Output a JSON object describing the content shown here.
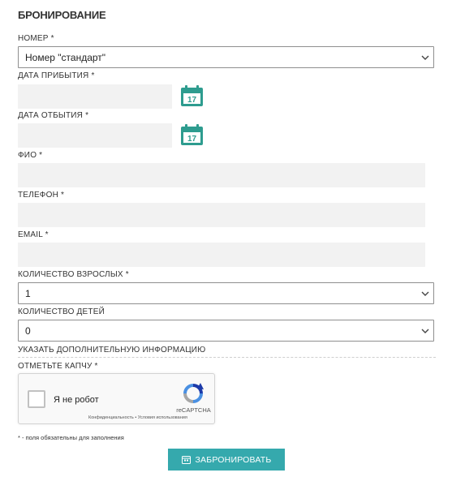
{
  "form": {
    "title": "БРОНИРОВАНИЕ",
    "room": {
      "label": "НОМЕР *",
      "value": "Номер \"стандарт\""
    },
    "arrival": {
      "label": "ДАТА ПРИБЫТИЯ *",
      "value": "",
      "calendar_day": "17"
    },
    "departure": {
      "label": "ДАТА ОТБЫТИЯ *",
      "value": "",
      "calendar_day": "17"
    },
    "fio": {
      "label": "ФИО *",
      "value": ""
    },
    "phone": {
      "label": "ТЕЛЕФОН *",
      "value": ""
    },
    "email": {
      "label": "EMAIL *",
      "value": ""
    },
    "adults": {
      "label": "КОЛИЧЕСТВО ВЗРОСЛЫХ *",
      "value": "1"
    },
    "children": {
      "label": "КОЛИЧЕСТВО ДЕТЕЙ",
      "value": "0"
    },
    "extra_info_label": "УКАЗАТЬ ДОПОЛНИТЕЛЬНУЮ ИНФОРМАЦИЮ",
    "captcha": {
      "label": "ОТМЕТЬТЕ КАПЧУ *",
      "checkbox_text": "Я не робот",
      "brand": "reCAPTCHA",
      "links": "Конфиденциальность • Условия использования"
    },
    "required_note": "* - поля обязательны для заполнения",
    "submit_label": "ЗАБРОНИРОВАТЬ"
  },
  "colors": {
    "accent": "#35a9ad",
    "calendar": "#2e9c8f",
    "field_bg": "#f2f2f2"
  },
  "icons": {
    "calendar": "calendar-icon",
    "chevron": "chevron-down-icon",
    "recaptcha": "recaptcha-logo-icon"
  }
}
